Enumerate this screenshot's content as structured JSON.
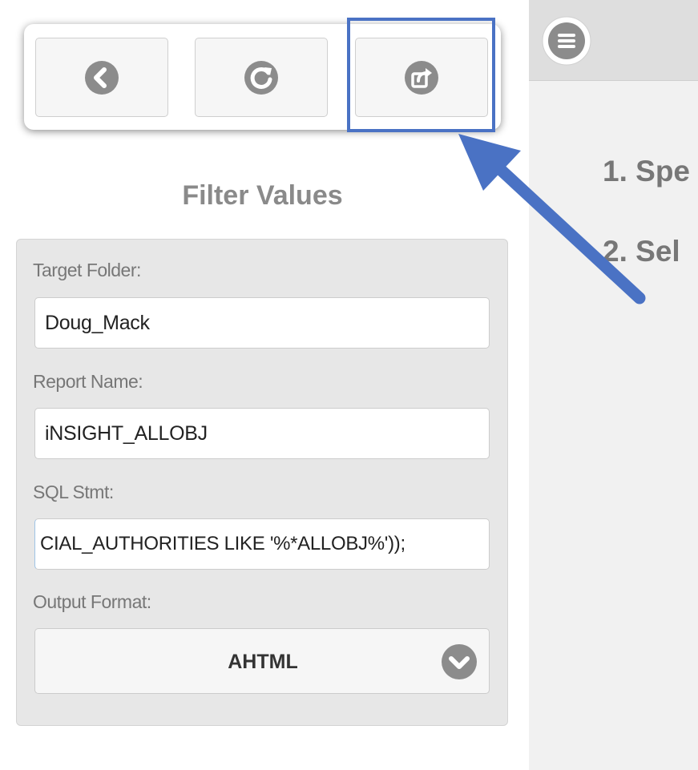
{
  "toolbar": {
    "buttons": [
      {
        "icon": "back-icon"
      },
      {
        "icon": "refresh-icon"
      },
      {
        "icon": "export-icon"
      }
    ]
  },
  "filter": {
    "title": "Filter Values",
    "target_folder": {
      "label": "Target Folder:",
      "value": "Doug_Mack"
    },
    "report_name": {
      "label": "Report Name:",
      "value": "iNSIGHT_ALLOBJ"
    },
    "sql_stmt": {
      "label": "SQL Stmt:",
      "value": "CIAL_AUTHORITIES LIKE '%*ALLOBJ%'));"
    },
    "output_format": {
      "label": "Output Format:",
      "value": "AHTML",
      "icon": "chevron-down-icon"
    }
  },
  "main": {
    "menu_icon": "menu-icon",
    "steps": [
      "1. Spe",
      "2. Sel"
    ]
  },
  "annotation": {
    "highlight_color": "#4a72c4",
    "arrow_color": "#4a72c4"
  },
  "colors": {
    "icon_gray": "#8c8c8c",
    "panel_bg": "#e7e7e7"
  }
}
